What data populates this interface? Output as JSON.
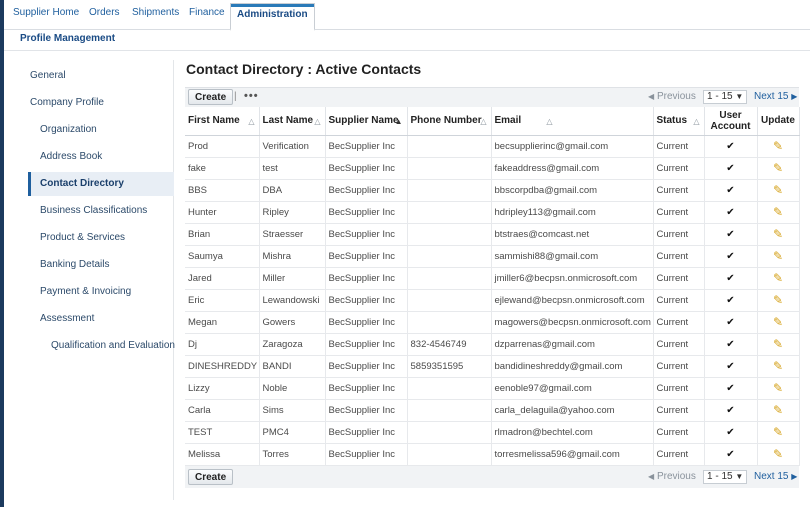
{
  "topnav": {
    "tabs": [
      {
        "label": "Supplier Home"
      },
      {
        "label": "Orders"
      },
      {
        "label": "Shipments"
      },
      {
        "label": "Finance"
      },
      {
        "label": "Administration"
      }
    ]
  },
  "subnav": {
    "title": "Profile Management"
  },
  "sidebar": {
    "items": [
      {
        "label": "General"
      },
      {
        "label": "Company Profile"
      },
      {
        "label": "Organization"
      },
      {
        "label": "Address Book"
      },
      {
        "label": "Contact Directory"
      },
      {
        "label": "Business Classifications"
      },
      {
        "label": "Product & Services"
      },
      {
        "label": "Banking Details"
      },
      {
        "label": "Payment & Invoicing"
      },
      {
        "label": "Assessment"
      },
      {
        "label": "Qualification and Evaluation"
      }
    ]
  },
  "main": {
    "title": "Contact Directory : Active Contacts",
    "create_label": "Create",
    "separator": "|",
    "more": "•••",
    "pager": {
      "prev": "Previous",
      "range": "1 - 15",
      "next": "Next 15"
    },
    "columns": [
      {
        "label": "First Name"
      },
      {
        "label": "Last Name"
      },
      {
        "label": "Supplier Name"
      },
      {
        "label": "Phone Number"
      },
      {
        "label": "Email"
      },
      {
        "label": "Status"
      },
      {
        "label": "User Account"
      },
      {
        "label": "Update"
      }
    ],
    "rows": [
      {
        "first": "Prod",
        "last": "Verification",
        "supplier": "BecSupplier Inc",
        "phone": "",
        "email": "becsupplierinc@gmail.com",
        "status": "Current",
        "account": "✔",
        "update": "✎"
      },
      {
        "first": "fake",
        "last": "test",
        "supplier": "BecSupplier Inc",
        "phone": "",
        "email": "fakeaddress@gmail.com",
        "status": "Current",
        "account": "✔",
        "update": "✎"
      },
      {
        "first": "BBS",
        "last": "DBA",
        "supplier": "BecSupplier Inc",
        "phone": "",
        "email": "bbscorpdba@gmail.com",
        "status": "Current",
        "account": "✔",
        "update": "✎"
      },
      {
        "first": "Hunter",
        "last": "Ripley",
        "supplier": "BecSupplier Inc",
        "phone": "",
        "email": "hdripley113@gmail.com",
        "status": "Current",
        "account": "✔",
        "update": "✎"
      },
      {
        "first": "Brian",
        "last": "Straesser",
        "supplier": "BecSupplier Inc",
        "phone": "",
        "email": "btstraes@comcast.net",
        "status": "Current",
        "account": "✔",
        "update": "✎"
      },
      {
        "first": "Saumya",
        "last": "Mishra",
        "supplier": "BecSupplier Inc",
        "phone": "",
        "email": "sammishi88@gmail.com",
        "status": "Current",
        "account": "✔",
        "update": "✎"
      },
      {
        "first": "Jared",
        "last": "Miller",
        "supplier": "BecSupplier Inc",
        "phone": "",
        "email": "jmiller6@becpsn.onmicrosoft.com",
        "status": "Current",
        "account": "✔",
        "update": "✎"
      },
      {
        "first": "Eric",
        "last": "Lewandowski",
        "supplier": "BecSupplier Inc",
        "phone": "",
        "email": "ejlewand@becpsn.onmicrosoft.com",
        "status": "Current",
        "account": "✔",
        "update": "✎"
      },
      {
        "first": "Megan",
        "last": "Gowers",
        "supplier": "BecSupplier Inc",
        "phone": "",
        "email": "magowers@becpsn.onmicrosoft.com",
        "status": "Current",
        "account": "✔",
        "update": "✎"
      },
      {
        "first": "Dj",
        "last": "Zaragoza",
        "supplier": "BecSupplier Inc",
        "phone": "832-4546749",
        "email": "dzparrenas@gmail.com",
        "status": "Current",
        "account": "✔",
        "update": "✎"
      },
      {
        "first": "DINESHREDDY",
        "last": "BANDI",
        "supplier": "BecSupplier Inc",
        "phone": "5859351595",
        "email": "bandidineshreddy@gmail.com",
        "status": "Current",
        "account": "✔",
        "update": "✎"
      },
      {
        "first": "Lizzy",
        "last": "Noble",
        "supplier": "BecSupplier Inc",
        "phone": "",
        "email": "eenoble97@gmail.com",
        "status": "Current",
        "account": "✔",
        "update": "✎"
      },
      {
        "first": "Carla",
        "last": "Sims",
        "supplier": "BecSupplier Inc",
        "phone": "",
        "email": "carla_delaguila@yahoo.com",
        "status": "Current",
        "account": "✔",
        "update": "✎"
      },
      {
        "first": "TEST",
        "last": "PMC4",
        "supplier": "BecSupplier Inc",
        "phone": "",
        "email": "rlmadron@bechtel.com",
        "status": "Current",
        "account": "✔",
        "update": "✎"
      },
      {
        "first": "Melissa",
        "last": "Torres",
        "supplier": "BecSupplier Inc",
        "phone": "",
        "email": "torresmelissa596@gmail.com",
        "status": "Current",
        "account": "✔",
        "update": "✎"
      }
    ]
  },
  "colors": {
    "accent": "#1f5f9e",
    "nav_dark": "#1c3a5e",
    "pencil": "#d4a017"
  },
  "icons": {
    "sort": "sort-triangle-icon",
    "check": "check-icon",
    "edit": "pencil-icon",
    "prev": "left-arrow-icon",
    "next": "right-arrow-icon",
    "dropdown": "chevron-down-icon"
  }
}
